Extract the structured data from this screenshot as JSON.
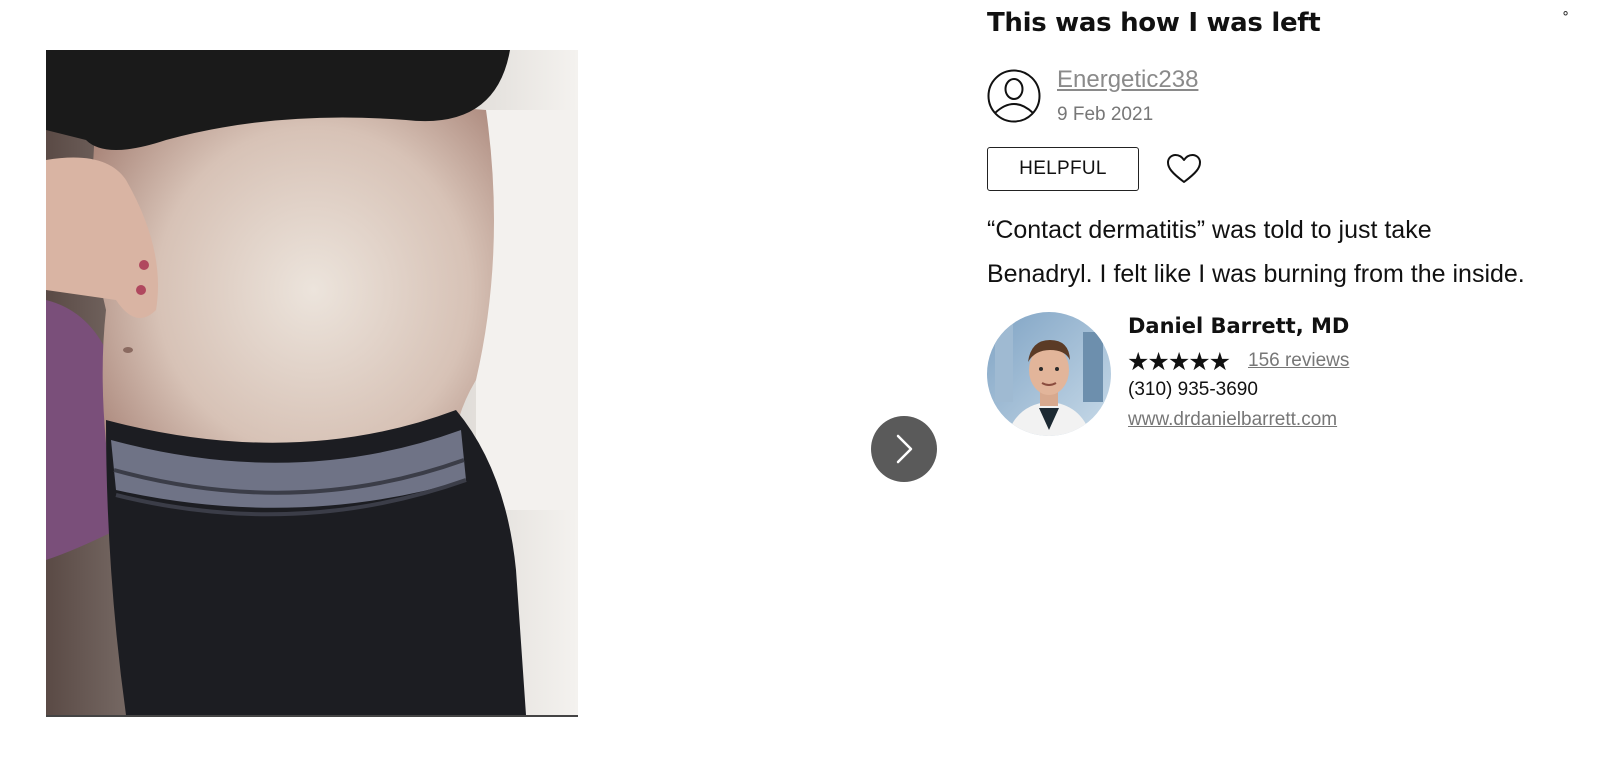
{
  "review": {
    "title": "This was how I was left",
    "username": "Energetic238",
    "date": "9 Feb 2021",
    "helpful_label": "HELPFUL",
    "body_lines": [
      "“Contact dermatitis” was told to just take",
      "Benadryl. I felt like I was burning from the inside."
    ]
  },
  "doctor": {
    "name": "Daniel Barrett, MD",
    "stars": "★★★★★",
    "rating": 5,
    "reviews_label": "156 reviews",
    "phone": "(310) 935-3690",
    "website": "www.drdanielbarrett.com"
  },
  "icons": {
    "avatar": "user-avatar-icon",
    "heart": "heart-icon",
    "next": "chevron-right-icon"
  },
  "colors": {
    "next_button": "#5a5a5a",
    "muted_text": "#777777"
  }
}
